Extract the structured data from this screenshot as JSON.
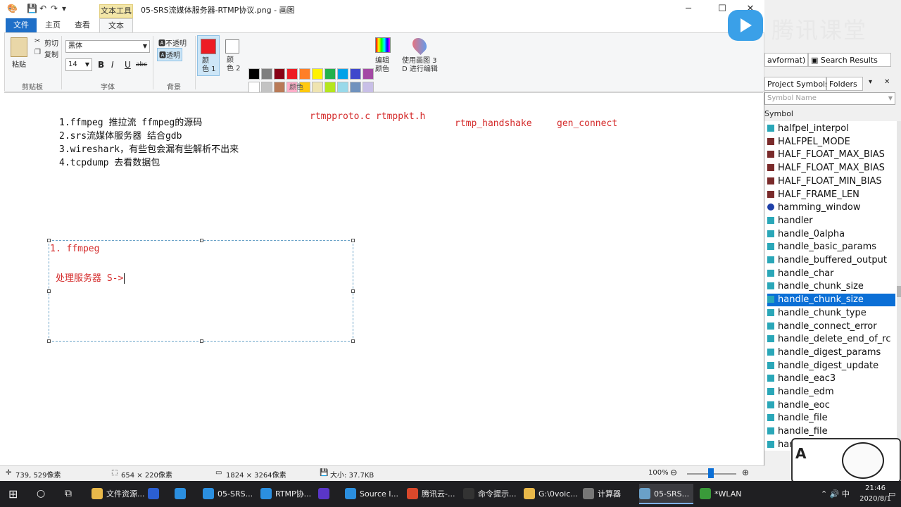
{
  "window": {
    "ctx_tab": "文本工具",
    "title": "05-SRS流媒体服务器-RTMP协议.png - 画图"
  },
  "tabs": [
    "文件",
    "主页",
    "查看",
    "文本"
  ],
  "ribbon": {
    "paste": "粘贴",
    "cut": "剪切",
    "copy": "复制",
    "clipboard_label": "剪贴板",
    "font_name": "黑体",
    "font_size": "14",
    "bold": "B",
    "italic": "I",
    "underline": "U",
    "strike": "abc",
    "font_label": "字体",
    "opaque": "不透明",
    "transparent": "透明",
    "bg_label": "背景",
    "color1": "颜\n色 1",
    "color2": "颜\n色 2",
    "edit_colors": "编辑\n颜色",
    "paint3d": "使用画图 3\nD 进行编辑",
    "colors_label": "颜色",
    "palette": [
      "#000000",
      "#7f7f7f",
      "#880015",
      "#ed1c24",
      "#ff7f27",
      "#fff200",
      "#22b14c",
      "#00a2e8",
      "#3f48cc",
      "#a349a4",
      "#ffffff",
      "#c3c3c3",
      "#b97a57",
      "#ffaec9",
      "#ffc90e",
      "#efe4b0",
      "#b5e61d",
      "#99d9ea",
      "#7092be",
      "#c8bfe7"
    ]
  },
  "canvas": {
    "lines": [
      "1.ffmpeg  推拉流  ffmpeg的源码",
      "2.srs流媒体服务器 结合gdb",
      "3.wireshark，有些包会漏有些解析不出来",
      "4.tcpdump 去看数据包"
    ],
    "red1": "rtmpproto.c rtmppkt.h",
    "red2": "rtmp_handshake",
    "red3": "gen_connect",
    "box_line1": "1. ffmpeg",
    "box_line2": "处理服务器 S->"
  },
  "status": {
    "cursor": "739, 529像素",
    "selection": "654 × 220像素",
    "image_size": "1824 × 3264像素",
    "file_size": "大小: 37.7KB",
    "zoom": "100%"
  },
  "right_panel": {
    "logo": "腾讯课堂",
    "tab_avformat": "avformat)",
    "tab_search": "Search Results",
    "tab_project": "Project Symbols",
    "tab_folders": "Folders",
    "symbol_placeholder": "Symbol Name",
    "symbol_header": "Symbol",
    "symbols": [
      {
        "name": "halfpel_interpol",
        "kind": "func"
      },
      {
        "name": "HALFPEL_MODE",
        "kind": "macro"
      },
      {
        "name": "HALF_FLOAT_MAX_BIAS",
        "kind": "macro"
      },
      {
        "name": "HALF_FLOAT_MAX_BIAS",
        "kind": "macro"
      },
      {
        "name": "HALF_FLOAT_MIN_BIAS",
        "kind": "macro"
      },
      {
        "name": "HALF_FRAME_LEN",
        "kind": "macro"
      },
      {
        "name": "hamming_window",
        "kind": "var"
      },
      {
        "name": "handler",
        "kind": "func"
      },
      {
        "name": "handle_0alpha",
        "kind": "func"
      },
      {
        "name": "handle_basic_params",
        "kind": "func"
      },
      {
        "name": "handle_buffered_output",
        "kind": "func"
      },
      {
        "name": "handle_char",
        "kind": "func"
      },
      {
        "name": "handle_chunk_size",
        "kind": "func"
      },
      {
        "name": "handle_chunk_size",
        "kind": "func",
        "selected": true
      },
      {
        "name": "handle_chunk_type",
        "kind": "func"
      },
      {
        "name": "handle_connect_error",
        "kind": "func"
      },
      {
        "name": "handle_delete_end_of_rc",
        "kind": "func"
      },
      {
        "name": "handle_digest_params",
        "kind": "func"
      },
      {
        "name": "handle_digest_update",
        "kind": "func"
      },
      {
        "name": "handle_eac3",
        "kind": "func"
      },
      {
        "name": "handle_edm",
        "kind": "func"
      },
      {
        "name": "handle_eoc",
        "kind": "func"
      },
      {
        "name": "handle_file",
        "kind": "func"
      },
      {
        "name": "handle_file",
        "kind": "func"
      },
      {
        "name": "han",
        "kind": "func"
      }
    ]
  },
  "taskbar": {
    "items": [
      "文件资源...",
      "",
      "",
      "05-SRS...",
      "RTMP协...",
      "",
      "Source I...",
      "腾讯云-...",
      "命令提示...",
      "G:\\0voic...",
      "计算器",
      "05-SRS...",
      "*WLAN"
    ],
    "time": "21:46",
    "date": "2020/8/1"
  }
}
